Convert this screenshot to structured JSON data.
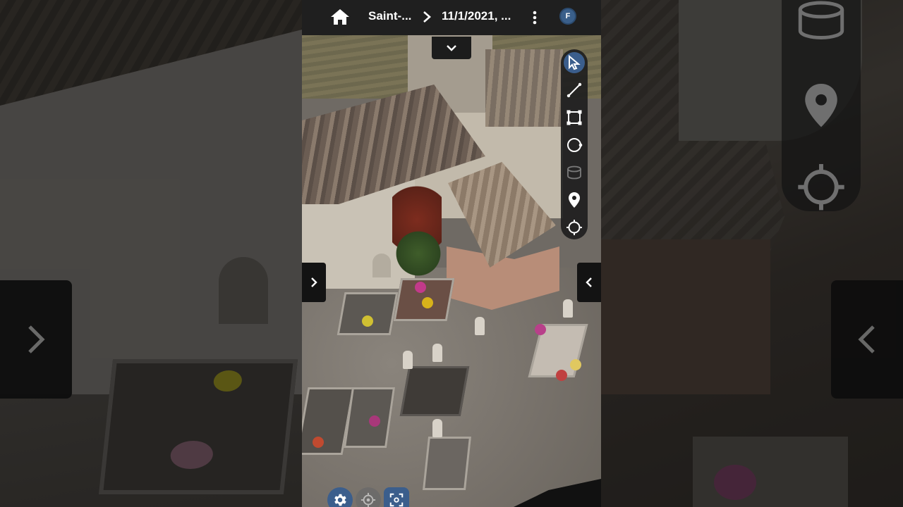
{
  "topbar": {
    "home_icon": "home-icon",
    "breadcrumb_1": "Saint-...",
    "breadcrumb_separator_icon": "chevron-right-icon",
    "breadcrumb_2": "11/1/2021, ...",
    "more_icon": "more-vertical-icon",
    "avatar_initial": "F"
  },
  "collapse_tab": {
    "icon": "chevron-down-icon"
  },
  "tools": [
    {
      "name": "select-tool",
      "icon": "cursor-icon",
      "active": true
    },
    {
      "name": "measure-line-tool",
      "icon": "line-icon",
      "active": false
    },
    {
      "name": "measure-area-tool",
      "icon": "polygon-icon",
      "active": false
    },
    {
      "name": "measure-circle-tool",
      "icon": "circle-icon",
      "active": false
    },
    {
      "name": "measure-volume-tool",
      "icon": "cylinder-icon",
      "active": false,
      "disabled": true
    },
    {
      "name": "annotation-tool",
      "icon": "map-pin-icon",
      "active": false
    },
    {
      "name": "locate-tool",
      "icon": "crosshair-icon",
      "active": false
    }
  ],
  "navigation": {
    "prev_icon": "chevron-right-icon",
    "next_icon": "chevron-left-icon"
  },
  "bottom_controls": [
    {
      "name": "settings-button",
      "icon": "gear-icon"
    },
    {
      "name": "recenter-button",
      "icon": "target-icon"
    },
    {
      "name": "fit-view-button",
      "icon": "fullscreen-icon"
    }
  ],
  "colors": {
    "accent": "#3b5e8c",
    "topbar_bg": "#1f1f1f",
    "toolbar_bg": "#1e1e1e"
  }
}
